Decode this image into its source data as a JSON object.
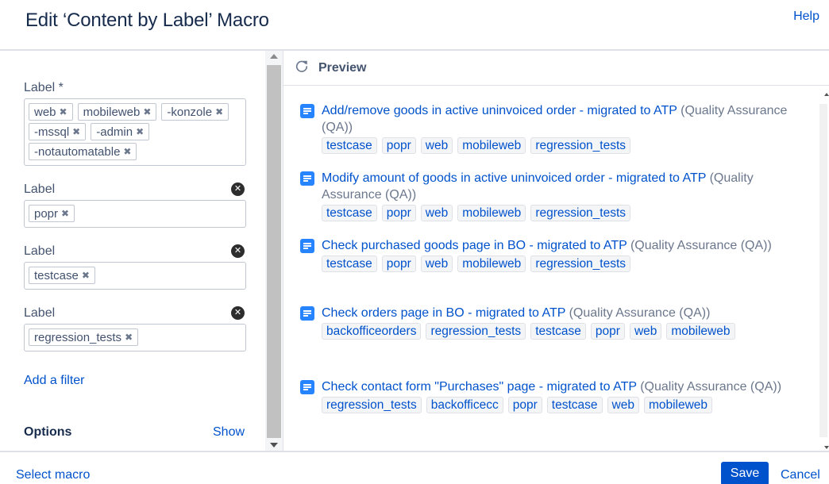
{
  "dialog": {
    "title": "Edit ‘Content by Label’ Macro",
    "help": "Help"
  },
  "filters": [
    {
      "label": "Label *",
      "removable": false,
      "values": [
        "web",
        "mobileweb",
        "-konzole",
        "-mssql",
        "-admin",
        "-notautomatable"
      ]
    },
    {
      "label": "Label",
      "removable": true,
      "values": [
        "popr"
      ]
    },
    {
      "label": "Label",
      "removable": true,
      "values": [
        "testcase"
      ]
    },
    {
      "label": "Label",
      "removable": true,
      "values": [
        "regression_tests"
      ]
    }
  ],
  "add_filter": "Add a filter",
  "options": {
    "label": "Options",
    "toggle": "Show"
  },
  "preview": {
    "title": "Preview",
    "results": [
      {
        "title": "Add/remove goods in active uninvoiced order - migrated to ATP",
        "space": "(Quality Assurance (QA))",
        "labels": [
          "testcase",
          "popr",
          "web",
          "mobileweb",
          "regression_tests"
        ]
      },
      {
        "title": "Modify amount of goods in active uninvoiced order - migrated to ATP",
        "space": "(Quality Assurance (QA))",
        "labels": [
          "testcase",
          "popr",
          "web",
          "mobileweb",
          "regression_tests"
        ]
      },
      {
        "title": "Check purchased goods page in BO - migrated to ATP",
        "space": "(Quality Assurance (QA))",
        "labels": [
          "testcase",
          "popr",
          "web",
          "mobileweb",
          "regression_tests"
        ]
      },
      {
        "title": "Check orders page in BO - migrated to ATP",
        "space": "(Quality Assurance (QA))",
        "labels": [
          "backofficeorders",
          "regression_tests",
          "testcase",
          "popr",
          "web",
          "mobileweb"
        ]
      },
      {
        "title": "Check contact form \"Purchases\" page - migrated to ATP",
        "space": "(Quality Assurance (QA))",
        "labels": [
          "regression_tests",
          "backofficecc",
          "popr",
          "testcase",
          "web",
          "mobileweb"
        ]
      }
    ]
  },
  "footer": {
    "select_macro": "Select macro",
    "save": "Save",
    "cancel": "Cancel"
  },
  "colors": {
    "link": "#0052cc",
    "primary_button": "#0052cc",
    "page_icon": "#2684ff"
  }
}
